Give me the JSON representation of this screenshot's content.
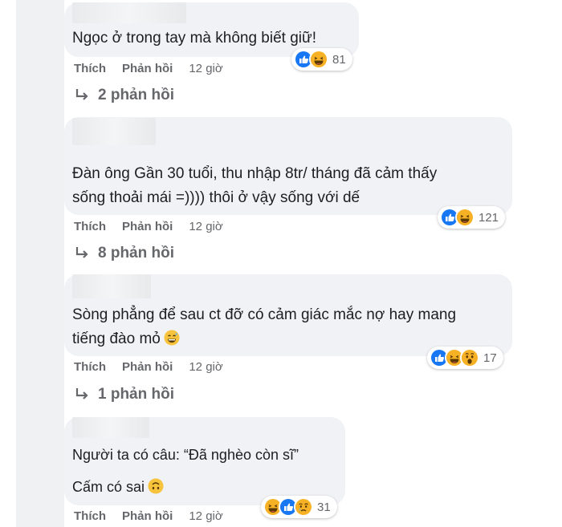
{
  "comments": [
    {
      "text_lines": [
        "Ngọc ở trong tay mà không biết giữ!"
      ],
      "actions": {
        "like": "Thích",
        "reply": "Phản hồi",
        "time": "12 giờ"
      },
      "reactions": {
        "icons": [
          "like-icon",
          "haha-icon"
        ],
        "count": "81"
      },
      "replies": "2 phản hồi"
    },
    {
      "text_lines": [
        "Đàn ông Gần 30 tuổi, thu nhập 8tr/ tháng đã cảm thấy",
        "sống thoải mái =)))) thôi ở vậy sống với dế"
      ],
      "actions": {
        "like": "Thích",
        "reply": "Phản hồi",
        "time": "12 giờ"
      },
      "reactions": {
        "icons": [
          "like-icon",
          "haha-icon"
        ],
        "count": "121"
      },
      "replies": "8 phản hồi"
    },
    {
      "text_lines": [
        "Sòng phẳng để sau ct đỡ có cảm giác mắc nợ hay mang",
        "tiếng đào mỏ"
      ],
      "actions": {
        "like": "Thích",
        "reply": "Phản hồi",
        "time": "12 giờ"
      },
      "reactions": {
        "icons": [
          "like-icon",
          "haha-icon",
          "wow-icon"
        ],
        "count": "17"
      },
      "replies": "1 phản hồi"
    },
    {
      "text_lines": [
        "Người ta có câu: “Đã nghèo còn sĩ”",
        "Cấm có sai"
      ],
      "actions": {
        "like": "Thích",
        "reply": "Phản hồi",
        "time": "12 giờ"
      },
      "reactions": {
        "icons": [
          "haha-icon",
          "like-icon",
          "sad-icon"
        ],
        "count": "31"
      }
    }
  ],
  "colors": {
    "like": "#1877f2",
    "emoji": "#f7b125",
    "muted": "#65676b",
    "bubble": "#f0f2f5"
  }
}
